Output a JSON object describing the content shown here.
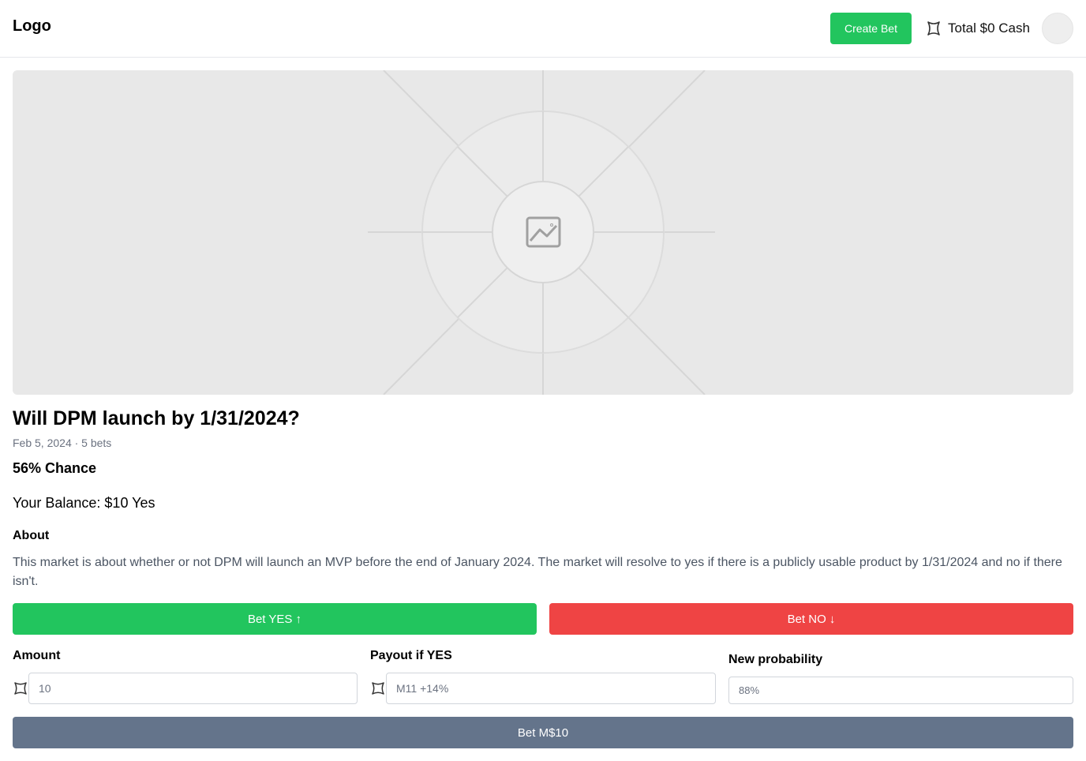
{
  "header": {
    "logo": "Logo",
    "create_bet_label": "Create Bet",
    "cash_label": "Total $0 Cash"
  },
  "market": {
    "title": "Will DPM launch by 1/31/2024?",
    "meta": "Feb 5, 2024 · 5 bets",
    "chance": "56% Chance",
    "balance": "Your Balance: $10 Yes",
    "about_heading": "About",
    "about_text": "This market is about whether or not DPM will launch an MVP before the end of January 2024. The market will resolve to yes if there is a publicly usable product by 1/31/2024 and no if there isn't."
  },
  "actions": {
    "bet_yes_label": "Bet YES ↑",
    "bet_no_label": "Bet NO ↓"
  },
  "form": {
    "amount_label": "Amount",
    "amount_placeholder": "10",
    "payout_label": "Payout if YES",
    "payout_placeholder": "M11 +14%",
    "probability_label": "New probability",
    "probability_placeholder": "88%",
    "submit_label": "Bet M$10"
  },
  "icons": {
    "currency": "coin-icon",
    "hero": "image-placeholder-icon"
  },
  "colors": {
    "yes": "#22c55e",
    "no": "#ef4444",
    "submit": "#64748b"
  }
}
